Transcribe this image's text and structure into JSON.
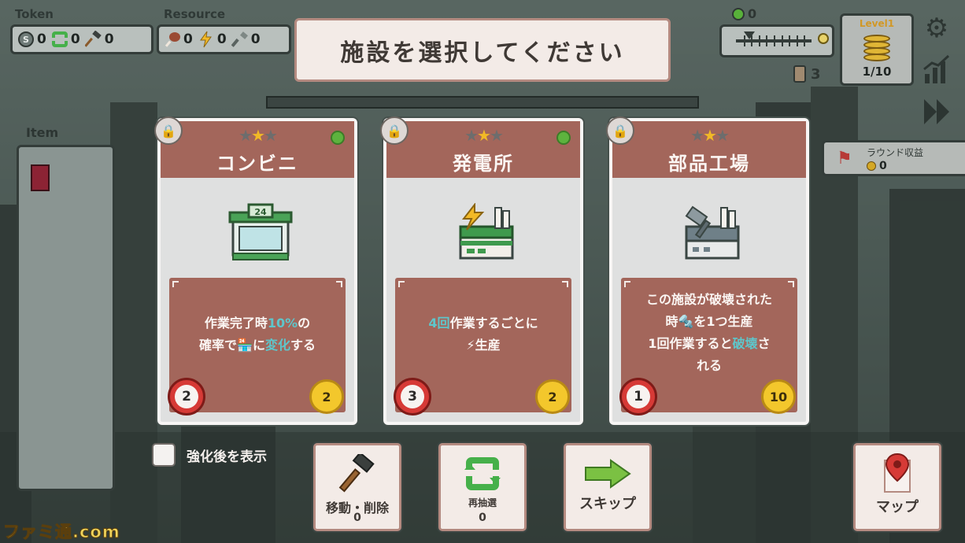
{
  "title": "施設を選択してください",
  "hud": {
    "token_label": "Token",
    "resource_label": "Resource",
    "tokens": [
      {
        "icon": "dollar-coin-icon",
        "value": "0"
      },
      {
        "icon": "reroll-icon",
        "value": "0"
      },
      {
        "icon": "hammer-icon",
        "value": "0"
      }
    ],
    "resources": [
      {
        "icon": "meat-icon",
        "value": "0"
      },
      {
        "icon": "lightning-icon",
        "value": "0"
      },
      {
        "icon": "screw-icon",
        "value": "0"
      }
    ],
    "gems": "0",
    "level_label": "Level1",
    "level_progress": "1/10",
    "people": "3",
    "round_income_label": "ラウンド収益",
    "round_income_value": "0"
  },
  "item_panel": {
    "label": "Item",
    "items": [
      {
        "icon": "passport-icon"
      }
    ]
  },
  "cards": [
    {
      "name": "コンビニ",
      "stars_total": 3,
      "stars_filled": 1,
      "has_indicator": true,
      "icon": "convenience-store-icon",
      "desc_lines": [
        [
          {
            "t": "作業完了時"
          },
          {
            "t": "10%",
            "hl": true
          },
          {
            "t": "の"
          }
        ],
        [
          {
            "t": "確率で"
          },
          {
            "t": "🏪"
          },
          {
            "t": "に"
          },
          {
            "t": "変化",
            "hl": true
          },
          {
            "t": "する"
          }
        ]
      ],
      "time": "2",
      "cost": "2"
    },
    {
      "name": "発電所",
      "stars_total": 3,
      "stars_filled": 1,
      "has_indicator": true,
      "icon": "power-plant-icon",
      "desc_lines": [
        [
          {
            "t": "4回",
            "hl": true
          },
          {
            "t": "作業するごとに"
          }
        ],
        [
          {
            "t": "⚡"
          },
          {
            "t": "生産"
          }
        ]
      ],
      "time": "3",
      "cost": "2"
    },
    {
      "name": "部品工場",
      "stars_total": 3,
      "stars_filled": 1,
      "has_indicator": false,
      "icon": "parts-factory-icon",
      "desc_lines": [
        [
          {
            "t": "この施設が破壊された"
          }
        ],
        [
          {
            "t": "時"
          },
          {
            "t": "🔩"
          },
          {
            "t": "を1つ生産"
          }
        ],
        [
          {
            "t": "1回作業すると"
          },
          {
            "t": "破壊",
            "hl": true
          },
          {
            "t": "さ"
          }
        ],
        [
          {
            "t": "れる"
          }
        ]
      ],
      "time": "1",
      "cost": "10"
    }
  ],
  "controls": {
    "show_upgraded_label": "強化後を表示",
    "move_delete_label": "移動・削除",
    "move_delete_count": "0",
    "reroll_label": "再抽選",
    "reroll_count": "0",
    "skip_label": "スキップ",
    "map_label": "マップ"
  },
  "watermark": "ファミ通.com",
  "colors": {
    "card_header": "#a3665b",
    "highlight": "#5ec6cb",
    "star_gold": "#f2b926",
    "timer_red": "#d63a36",
    "coin_gold": "#f3c72c"
  }
}
